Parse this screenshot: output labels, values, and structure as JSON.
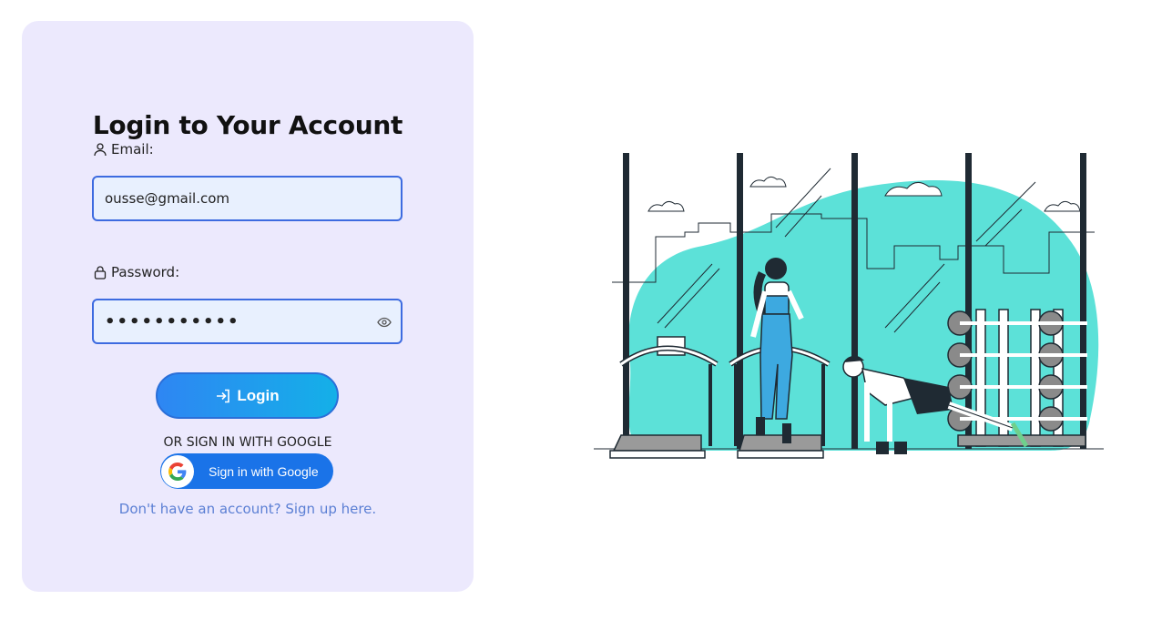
{
  "login": {
    "title": "Login to Your Account",
    "email_label": "Email:",
    "email_value": "ousse@gmail.com",
    "password_label": "Password:",
    "password_value": "•••••••••••",
    "login_button": "Login",
    "or_text": "OR SIGN IN WITH GOOGLE",
    "google_button": "Sign in with Google",
    "signup_link": "Don't have an account? Sign up here."
  },
  "icons": {
    "user": "user-icon",
    "lock": "lock-icon",
    "eye": "eye-icon",
    "login": "login-arrow-icon",
    "google": "google-logo-icon"
  },
  "colors": {
    "card_bg": "#ece9fd",
    "input_border": "#3d6be0",
    "input_bg": "#e8f0fe",
    "button_gradient_start": "#2e86f3",
    "button_gradient_end": "#14b0e8",
    "google_blue": "#1a73e8",
    "link": "#5b7fd4",
    "illustration_teal": "#5ce1d8"
  }
}
